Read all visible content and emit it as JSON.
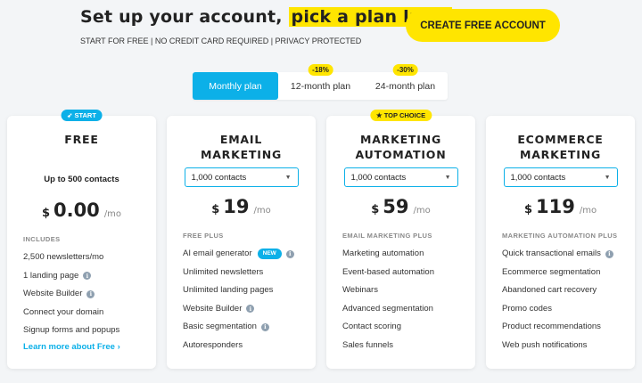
{
  "hero": {
    "title_part1": "Set up your account, ",
    "title_highlight": "pick a plan later",
    "subtitle": "START FOR FREE | NO CREDIT CARD REQUIRED | PRIVACY PROTECTED",
    "cta_label": "CREATE FREE ACCOUNT"
  },
  "billing_toggle": {
    "options": [
      {
        "label": "Monthly plan",
        "discount": "",
        "selected": true
      },
      {
        "label": "12-month plan",
        "discount": "-18%",
        "selected": false
      },
      {
        "label": "24-month plan",
        "discount": "-30%",
        "selected": false
      }
    ]
  },
  "colors": {
    "accent_blue": "#0cb0e8",
    "accent_yellow": "#ffe500",
    "background": "#f3f5f7"
  },
  "icons": {
    "rocket": "rocket-icon",
    "star": "star-icon",
    "info": "info-icon",
    "chevron": "chevron-down-icon"
  },
  "plans": [
    {
      "badge": "START",
      "name_line1": "FREE",
      "name_line2": "",
      "contacts": "Up to 500 contacts",
      "currency": "$",
      "price": "0.00",
      "period": "/mo",
      "section": "INCLUDES",
      "features": [
        "2,500 newsletters/mo",
        "1 landing page",
        "Website Builder",
        "Connect your domain",
        "Signup forms and popups"
      ],
      "link": "Learn more about Free ›"
    },
    {
      "name_line1": "EMAIL",
      "name_line2": "MARKETING",
      "contacts": "1,000 contacts",
      "currency": "$",
      "price": "19",
      "period": "/mo",
      "section": "FREE PLUS",
      "new_label": "NEW",
      "features": [
        "AI email generator",
        "Unlimited newsletters",
        "Unlimited landing pages",
        "Website Builder",
        "Basic segmentation",
        "Autoresponders"
      ]
    },
    {
      "badge": "TOP CHOICE",
      "name_line1": "MARKETING",
      "name_line2": "AUTOMATION",
      "contacts": "1,000 contacts",
      "currency": "$",
      "price": "59",
      "period": "/mo",
      "section": "EMAIL MARKETING PLUS",
      "features": [
        "Marketing automation",
        "Event-based automation",
        "Webinars",
        "Advanced segmentation",
        "Contact scoring",
        "Sales funnels"
      ]
    },
    {
      "name_line1": "ECOMMERCE",
      "name_line2": "MARKETING",
      "contacts": "1,000 contacts",
      "currency": "$",
      "price": "119",
      "period": "/mo",
      "section": "MARKETING AUTOMATION PLUS",
      "features": [
        "Quick transactional emails",
        "Ecommerce segmentation",
        "Abandoned cart recovery",
        "Promo codes",
        "Product recommendations",
        "Web push notifications"
      ]
    }
  ]
}
